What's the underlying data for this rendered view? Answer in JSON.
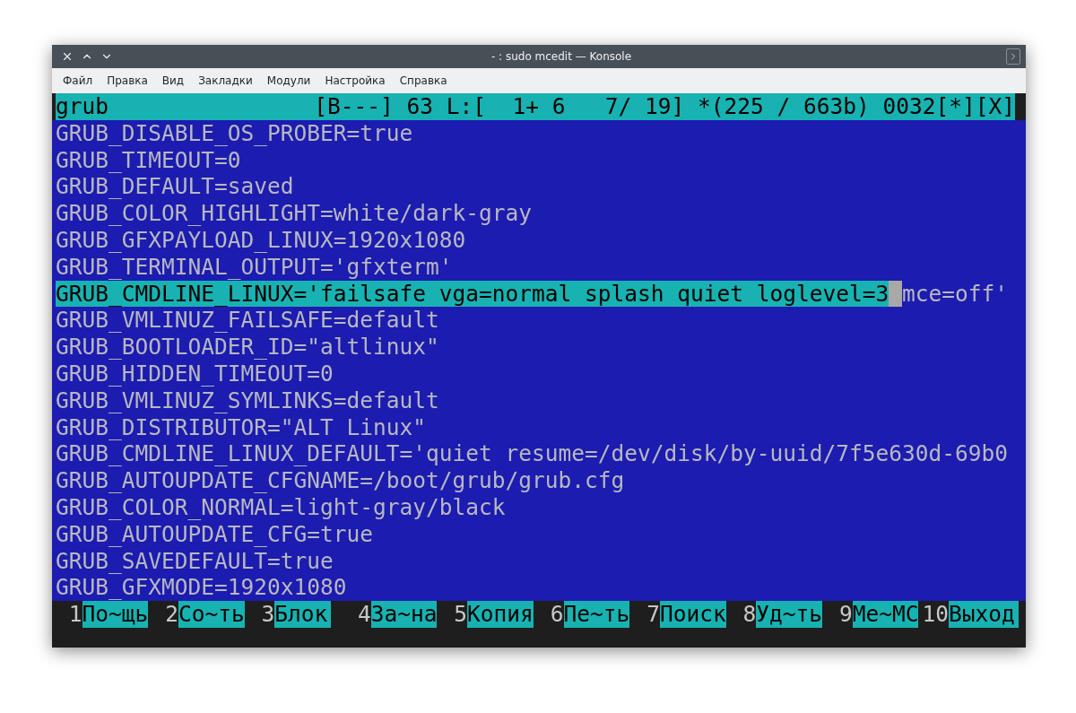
{
  "window": {
    "title": "- : sudo mcedit — Konsole"
  },
  "menu": [
    "Файл",
    "Правка",
    "Вид",
    "Закладки",
    "Модули",
    "Настройка",
    "Справка"
  ],
  "editor": {
    "status": {
      "file": "grub",
      "info": "[B---] 63 L:[  1+ 6   7/ 19] *(225 / 663b) 0032[*][X]"
    },
    "lines": [
      {
        "kind": "plain",
        "text": "GRUB_DISABLE_OS_PROBER=true"
      },
      {
        "kind": "plain",
        "text": "GRUB_TIMEOUT=0"
      },
      {
        "kind": "plain",
        "text": "GRUB_DEFAULT=saved"
      },
      {
        "kind": "plain",
        "text": "GRUB_COLOR_HIGHLIGHT=white/dark-gray"
      },
      {
        "kind": "plain",
        "text": "GRUB_GFXPAYLOAD_LINUX=1920x1080"
      },
      {
        "kind": "plain",
        "text": "GRUB_TERMINAL_OUTPUT='gfxterm'"
      },
      {
        "kind": "marked",
        "text": "GRUB_CMDLINE_LINUX='failsafe vga=normal splash quiet loglevel=3",
        "cursor": true,
        "rest": "mce=off'"
      },
      {
        "kind": "plain",
        "text": "GRUB_VMLINUZ_FAILSAFE=default"
      },
      {
        "kind": "plain",
        "text": "GRUB_BOOTLOADER_ID=\"altlinux\""
      },
      {
        "kind": "plain",
        "text": "GRUB_HIDDEN_TIMEOUT=0"
      },
      {
        "kind": "plain",
        "text": "GRUB_VMLINUZ_SYMLINKS=default"
      },
      {
        "kind": "plain",
        "text": "GRUB_DISTRIBUTOR=\"ALT Linux\""
      },
      {
        "kind": "plain",
        "text": "GRUB_CMDLINE_LINUX_DEFAULT='quiet resume=/dev/disk/by-uuid/7f5e630d-69b0"
      },
      {
        "kind": "plain",
        "text": "GRUB_AUTOUPDATE_CFGNAME=/boot/grub/grub.cfg"
      },
      {
        "kind": "plain",
        "text": "GRUB_COLOR_NORMAL=light-gray/black"
      },
      {
        "kind": "plain",
        "text": "GRUB_AUTOUPDATE_CFG=true"
      },
      {
        "kind": "plain",
        "text": "GRUB_SAVEDEFAULT=true"
      },
      {
        "kind": "plain",
        "text": "GRUB_GFXMODE=1920x1080"
      }
    ]
  },
  "keys": [
    {
      "number": "1",
      "label": "По~щь"
    },
    {
      "number": "2",
      "label": "Со~ть"
    },
    {
      "number": "3",
      "label": "Блок"
    },
    {
      "number": "4",
      "label": "За~на"
    },
    {
      "number": "5",
      "label": "Копия"
    },
    {
      "number": "6",
      "label": "Пе~ть"
    },
    {
      "number": "7",
      "label": "Поиск"
    },
    {
      "number": "8",
      "label": "Уд~ть"
    },
    {
      "number": "9",
      "label": "Ме~МС"
    },
    {
      "number": "10",
      "label": "Выход"
    }
  ]
}
